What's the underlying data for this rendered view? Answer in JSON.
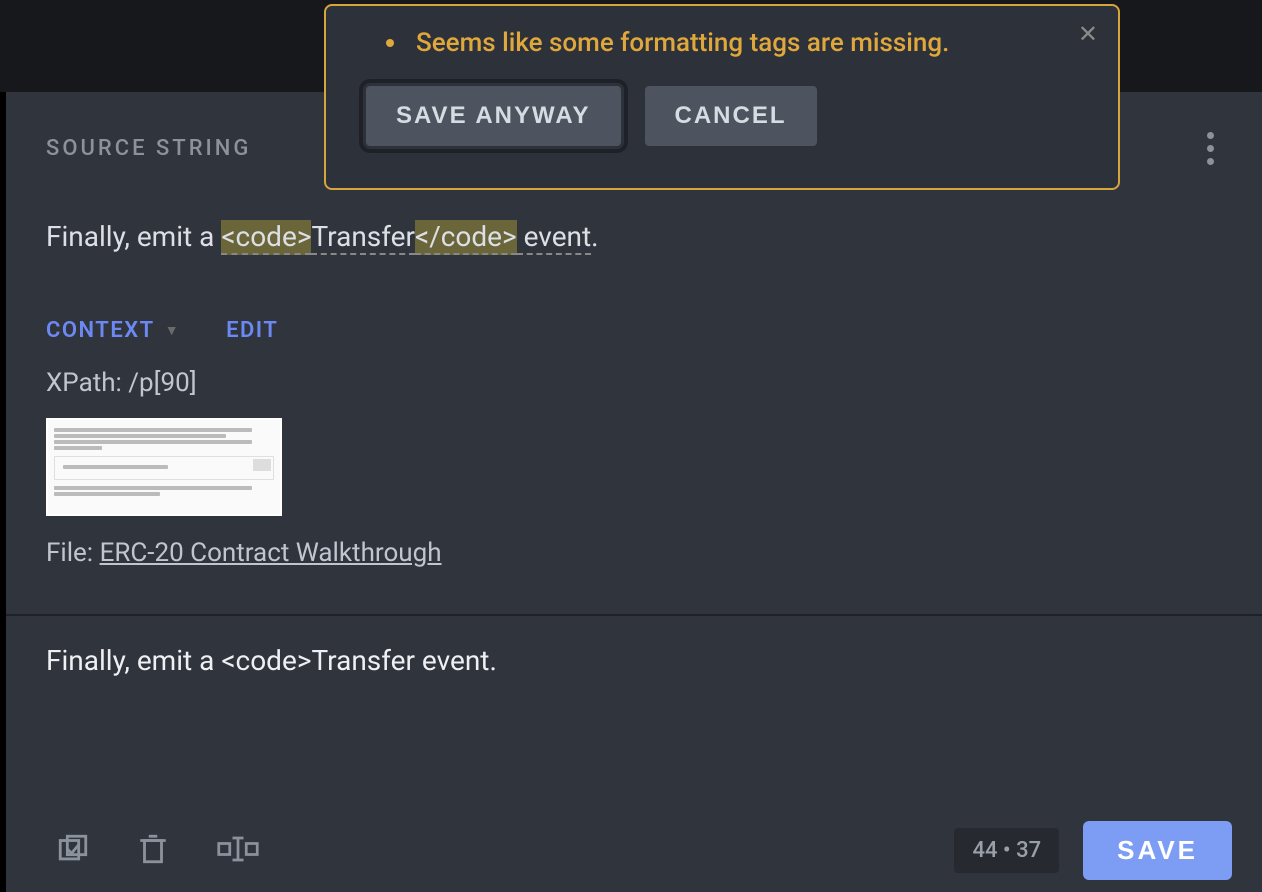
{
  "modal": {
    "message": "Seems like some formatting tags are missing.",
    "save_anyway_label": "SAVE ANYWAY",
    "cancel_label": "CANCEL"
  },
  "source": {
    "header_label": "SOURCE STRING",
    "string_prefix": "Finally, emit a ",
    "tag_open": "<code>",
    "string_mid": "Transfer",
    "tag_close": "</code>",
    "string_suffix": " event",
    "string_end": "."
  },
  "context": {
    "context_label": "CONTEXT",
    "edit_label": "EDIT",
    "xpath": "XPath: /p[90]",
    "file_label": "File: ",
    "file_name": "ERC-20 Contract Walkthrough"
  },
  "target": {
    "value": "Finally, emit a <code>Transfer event."
  },
  "footer": {
    "count_left": "44",
    "count_right": "37",
    "save_label": "SAVE"
  }
}
